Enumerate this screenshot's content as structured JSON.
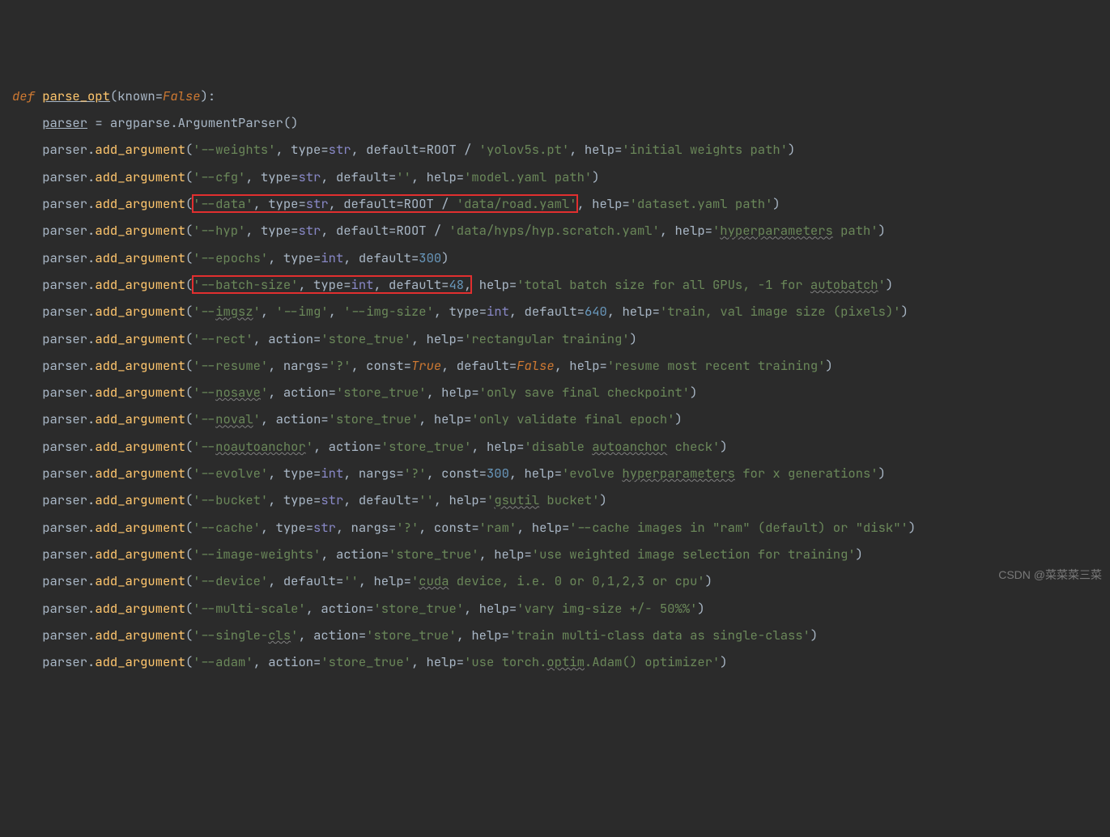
{
  "watermark": "CSDN @菜菜菜三菜",
  "code": {
    "l1": {
      "def": "def ",
      "fn": "parse_opt",
      "lp": "(",
      "known": "known",
      "eq": "=",
      "false": "False",
      "rp": "):"
    },
    "l2": {
      "pre": "    ",
      "parser": "parser",
      "eq": " = argparse.ArgumentParser()"
    },
    "l3": {
      "pre": "    parser.",
      "fn": "add_argument",
      "a": "(",
      "s1": "'--weights'",
      "c1": ", type=",
      "bi": "str",
      "c2": ", default=ROOT / ",
      "s2": "'yolov5s.pt'",
      "c3": ", help=",
      "s3": "'initial weights path'",
      "rp": ")"
    },
    "l4": {
      "pre": "    parser.",
      "fn": "add_argument",
      "a": "(",
      "s1": "'--cfg'",
      "c1": ", type=",
      "bi": "str",
      "c2": ", default=",
      "s2": "''",
      "c3": ", help=",
      "s3": "'model.yaml path'",
      "rp": ")"
    },
    "l5": {
      "pre": "    parser.",
      "fn": "add_argument",
      "a": "(",
      "box1": "'--data', type=str, default=ROOT / 'data/road.yaml'",
      "s1": "'--data'",
      "sep1": ", type=",
      "bi1": "str",
      "sep2": ", default=ROOT / ",
      "s2": "'data/road.yaml'",
      "after": ", help=",
      "s3": "'dataset.yaml path'",
      "rp": ")"
    },
    "l6": {
      "pre": "    parser.",
      "fn": "add_argument",
      "a": "(",
      "s1": "'--hyp'",
      "c1": ", type=",
      "bi": "str",
      "c2": ", default=ROOT / ",
      "s2": "'data/hyps/hyp.scratch.yaml'",
      "c3": ", help=",
      "s3": "'",
      "hp": "hyperparameters",
      "s3b": " path'",
      "rp": ")"
    },
    "l7": {
      "pre": "    parser.",
      "fn": "add_argument",
      "a": "(",
      "s1": "'--epochs'",
      "c1": ", type=",
      "bi": "int",
      "c2": ", default=",
      "n": "300",
      "rp": ")"
    },
    "l8": {
      "pre": "    parser.",
      "fn": "add_argument",
      "a": "(",
      "s1": "'--batch-size'",
      "sep1": ", type=",
      "bi1": "int",
      "sep2": ", default=",
      "n1": "48",
      "comma": ",",
      "after": " help=",
      "s3": "'total batch size for all GPUs, -1 for ",
      "ab": "autobatch",
      "s3b": "'",
      "rp": ")"
    },
    "l9": {
      "pre": "    parser.",
      "fn": "add_argument",
      "a": "(",
      "s1": "'--",
      "img": "imgsz",
      "s1b": "'",
      "c0": ", ",
      "s2": "'--img'",
      "c00": ", ",
      "s3": "'--img-size'",
      "c1": ", type=",
      "bi": "int",
      "c2": ", default=",
      "n": "640",
      "c3": ", help=",
      "s4": "'train, val image size (pixels)'",
      "rp": ")"
    },
    "l10": {
      "pre": "    parser.",
      "fn": "add_argument",
      "a": "(",
      "s1": "'--rect'",
      "c1": ", action=",
      "s2": "'store_true'",
      "c2": ", help=",
      "s3": "'rectangular training'",
      "rp": ")"
    },
    "l11": {
      "pre": "    parser.",
      "fn": "add_argument",
      "a": "(",
      "s1": "'--resume'",
      "c1": ", nargs=",
      "s2": "'?'",
      "c2": ", const=",
      "t": "True",
      "c3": ", default=",
      "f": "False",
      "c4": ", help=",
      "s3": "'resume most recent training'",
      "rp": ")"
    },
    "l12": {
      "pre": "    parser.",
      "fn": "add_argument",
      "a": "(",
      "s1": "'--",
      "ns": "nosave",
      "s1b": "'",
      "c1": ", action=",
      "s2": "'store_true'",
      "c2": ", help=",
      "s3": "'only save final checkpoint'",
      "rp": ")"
    },
    "l13": {
      "pre": "    parser.",
      "fn": "add_argument",
      "a": "(",
      "s1": "'--",
      "nv": "noval",
      "s1b": "'",
      "c1": ", action=",
      "s2": "'store_true'",
      "c2": ", help=",
      "s3": "'only validate final epoch'",
      "rp": ")"
    },
    "l14": {
      "pre": "    parser.",
      "fn": "add_argument",
      "a": "(",
      "s1": "'--",
      "na": "noautoanchor",
      "s1b": "'",
      "c1": ", action=",
      "s2": "'store_true'",
      "c2": ", help=",
      "s3": "'disable ",
      "aa": "autoanchor",
      "s3b": " check'",
      "rp": ")"
    },
    "l15": {
      "pre": "    parser.",
      "fn": "add_argument",
      "a": "(",
      "s1": "'--evolve'",
      "c1": ", type=",
      "bi": "int",
      "c2": ", nargs=",
      "s2": "'?'",
      "c3": ", const=",
      "n": "300",
      "c4": ", help=",
      "s3": "'evolve ",
      "hp": "hyperparameters",
      "s3b": " for x generations'",
      "rp": ")"
    },
    "l16": {
      "pre": "    parser.",
      "fn": "add_argument",
      "a": "(",
      "s1": "'--bucket'",
      "c1": ", type=",
      "bi": "str",
      "c2": ", default=",
      "s2": "''",
      "c3": ", help=",
      "s3": "'",
      "gs": "gsutil",
      "s3b": " bucket'",
      "rp": ")"
    },
    "l17": {
      "pre": "    parser.",
      "fn": "add_argument",
      "a": "(",
      "s1": "'--cache'",
      "c1": ", type=",
      "bi": "str",
      "c2": ", nargs=",
      "s2": "'?'",
      "c3": ", const=",
      "s3": "'ram'",
      "c4": ", help=",
      "s4": "'--cache images in \"ram\" (default) or \"disk\"'",
      "rp": ")"
    },
    "l18": {
      "pre": "    parser.",
      "fn": "add_argument",
      "a": "(",
      "s1": "'--image-weights'",
      "c1": ", action=",
      "s2": "'store_true'",
      "c2": ", help=",
      "s3": "'use weighted image selection for training'",
      "rp": ")"
    },
    "l19": {
      "pre": "    parser.",
      "fn": "add_argument",
      "a": "(",
      "s1": "'--device'",
      "c1": ", default=",
      "s2": "''",
      "c2": ", help=",
      "s3": "'",
      "cu": "cuda",
      "s3b": " device, i.e. 0 or 0,1,2,3 or cpu'",
      "rp": ")"
    },
    "l20": {
      "pre": "    parser.",
      "fn": "add_argument",
      "a": "(",
      "s1": "'--multi-scale'",
      "c1": ", action=",
      "s2": "'store_true'",
      "c2": ", help=",
      "s3": "'vary img-size +/- 50%%'",
      "rp": ")"
    },
    "l21": {
      "pre": "    parser.",
      "fn": "add_argument",
      "a": "(",
      "s1": "'--single-",
      "cls": "cls",
      "s1b": "'",
      "c1": ", action=",
      "s2": "'store_true'",
      "c2": ", help=",
      "s3": "'train multi-class data as single-class'",
      "rp": ")"
    },
    "l22": {
      "pre": "    parser.",
      "fn": "add_argument",
      "a": "(",
      "s1": "'--adam'",
      "c1": ", action=",
      "s2": "'store_true'",
      "c2": ", help=",
      "s3": "'use torch.",
      "op": "optim",
      "s3b": ".Adam() optimizer'",
      "rp": ")"
    }
  }
}
